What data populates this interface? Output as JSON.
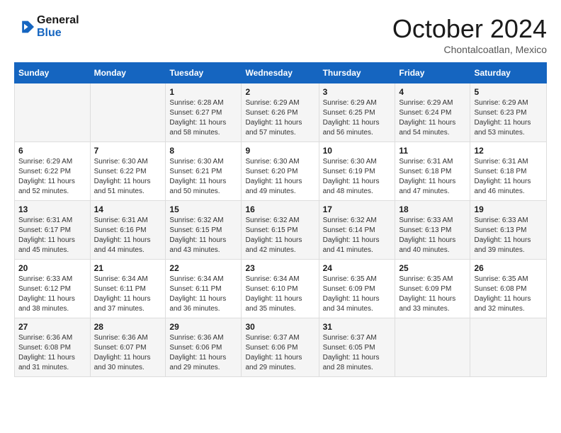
{
  "header": {
    "logo_line1": "General",
    "logo_line2": "Blue",
    "month_year": "October 2024",
    "location": "Chontalcoatlan, Mexico"
  },
  "weekdays": [
    "Sunday",
    "Monday",
    "Tuesday",
    "Wednesday",
    "Thursday",
    "Friday",
    "Saturday"
  ],
  "weeks": [
    [
      {
        "day": "",
        "info": ""
      },
      {
        "day": "",
        "info": ""
      },
      {
        "day": "1",
        "info": "Sunrise: 6:28 AM\nSunset: 6:27 PM\nDaylight: 11 hours\nand 58 minutes."
      },
      {
        "day": "2",
        "info": "Sunrise: 6:29 AM\nSunset: 6:26 PM\nDaylight: 11 hours\nand 57 minutes."
      },
      {
        "day": "3",
        "info": "Sunrise: 6:29 AM\nSunset: 6:25 PM\nDaylight: 11 hours\nand 56 minutes."
      },
      {
        "day": "4",
        "info": "Sunrise: 6:29 AM\nSunset: 6:24 PM\nDaylight: 11 hours\nand 54 minutes."
      },
      {
        "day": "5",
        "info": "Sunrise: 6:29 AM\nSunset: 6:23 PM\nDaylight: 11 hours\nand 53 minutes."
      }
    ],
    [
      {
        "day": "6",
        "info": "Sunrise: 6:29 AM\nSunset: 6:22 PM\nDaylight: 11 hours\nand 52 minutes."
      },
      {
        "day": "7",
        "info": "Sunrise: 6:30 AM\nSunset: 6:22 PM\nDaylight: 11 hours\nand 51 minutes."
      },
      {
        "day": "8",
        "info": "Sunrise: 6:30 AM\nSunset: 6:21 PM\nDaylight: 11 hours\nand 50 minutes."
      },
      {
        "day": "9",
        "info": "Sunrise: 6:30 AM\nSunset: 6:20 PM\nDaylight: 11 hours\nand 49 minutes."
      },
      {
        "day": "10",
        "info": "Sunrise: 6:30 AM\nSunset: 6:19 PM\nDaylight: 11 hours\nand 48 minutes."
      },
      {
        "day": "11",
        "info": "Sunrise: 6:31 AM\nSunset: 6:18 PM\nDaylight: 11 hours\nand 47 minutes."
      },
      {
        "day": "12",
        "info": "Sunrise: 6:31 AM\nSunset: 6:18 PM\nDaylight: 11 hours\nand 46 minutes."
      }
    ],
    [
      {
        "day": "13",
        "info": "Sunrise: 6:31 AM\nSunset: 6:17 PM\nDaylight: 11 hours\nand 45 minutes."
      },
      {
        "day": "14",
        "info": "Sunrise: 6:31 AM\nSunset: 6:16 PM\nDaylight: 11 hours\nand 44 minutes."
      },
      {
        "day": "15",
        "info": "Sunrise: 6:32 AM\nSunset: 6:15 PM\nDaylight: 11 hours\nand 43 minutes."
      },
      {
        "day": "16",
        "info": "Sunrise: 6:32 AM\nSunset: 6:15 PM\nDaylight: 11 hours\nand 42 minutes."
      },
      {
        "day": "17",
        "info": "Sunrise: 6:32 AM\nSunset: 6:14 PM\nDaylight: 11 hours\nand 41 minutes."
      },
      {
        "day": "18",
        "info": "Sunrise: 6:33 AM\nSunset: 6:13 PM\nDaylight: 11 hours\nand 40 minutes."
      },
      {
        "day": "19",
        "info": "Sunrise: 6:33 AM\nSunset: 6:13 PM\nDaylight: 11 hours\nand 39 minutes."
      }
    ],
    [
      {
        "day": "20",
        "info": "Sunrise: 6:33 AM\nSunset: 6:12 PM\nDaylight: 11 hours\nand 38 minutes."
      },
      {
        "day": "21",
        "info": "Sunrise: 6:34 AM\nSunset: 6:11 PM\nDaylight: 11 hours\nand 37 minutes."
      },
      {
        "day": "22",
        "info": "Sunrise: 6:34 AM\nSunset: 6:11 PM\nDaylight: 11 hours\nand 36 minutes."
      },
      {
        "day": "23",
        "info": "Sunrise: 6:34 AM\nSunset: 6:10 PM\nDaylight: 11 hours\nand 35 minutes."
      },
      {
        "day": "24",
        "info": "Sunrise: 6:35 AM\nSunset: 6:09 PM\nDaylight: 11 hours\nand 34 minutes."
      },
      {
        "day": "25",
        "info": "Sunrise: 6:35 AM\nSunset: 6:09 PM\nDaylight: 11 hours\nand 33 minutes."
      },
      {
        "day": "26",
        "info": "Sunrise: 6:35 AM\nSunset: 6:08 PM\nDaylight: 11 hours\nand 32 minutes."
      }
    ],
    [
      {
        "day": "27",
        "info": "Sunrise: 6:36 AM\nSunset: 6:08 PM\nDaylight: 11 hours\nand 31 minutes."
      },
      {
        "day": "28",
        "info": "Sunrise: 6:36 AM\nSunset: 6:07 PM\nDaylight: 11 hours\nand 30 minutes."
      },
      {
        "day": "29",
        "info": "Sunrise: 6:36 AM\nSunset: 6:06 PM\nDaylight: 11 hours\nand 29 minutes."
      },
      {
        "day": "30",
        "info": "Sunrise: 6:37 AM\nSunset: 6:06 PM\nDaylight: 11 hours\nand 29 minutes."
      },
      {
        "day": "31",
        "info": "Sunrise: 6:37 AM\nSunset: 6:05 PM\nDaylight: 11 hours\nand 28 minutes."
      },
      {
        "day": "",
        "info": ""
      },
      {
        "day": "",
        "info": ""
      }
    ]
  ]
}
